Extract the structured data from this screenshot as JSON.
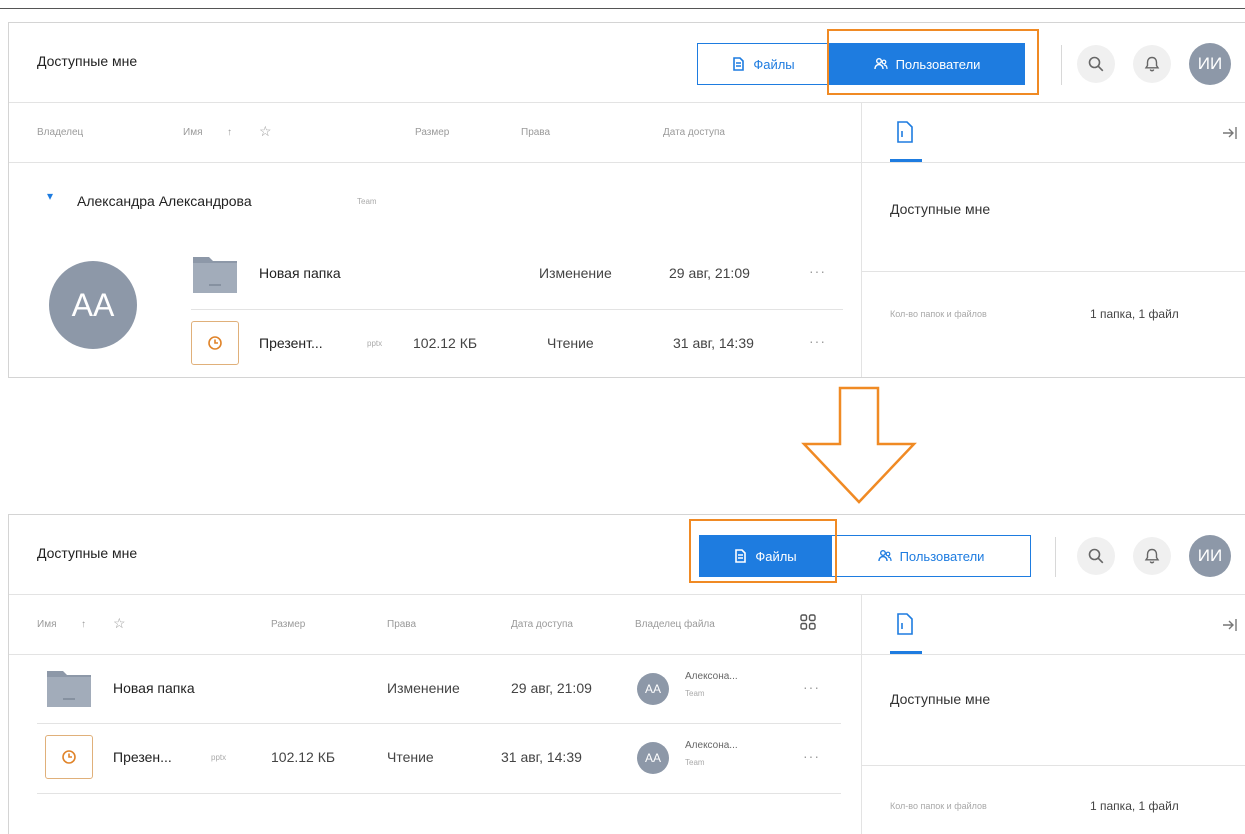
{
  "colors": {
    "accent": "#1e7ce0",
    "highlight": "#f08a24",
    "avatar": "#8d98a8"
  },
  "panel_top": {
    "title": "Доступные мне",
    "tab_files": "Файлы",
    "tab_users": "Пользователи",
    "user_initials": "ИИ",
    "columns": {
      "owner": "Владелец",
      "name": "Имя",
      "sort": "↑",
      "size": "Размер",
      "rights": "Права",
      "date": "Дата доступа"
    },
    "group": {
      "name": "Александра Александрова",
      "tag": "Team",
      "initials": "АА"
    },
    "rows": [
      {
        "name": "Новая папка",
        "ext": "",
        "size": "",
        "rights": "Изменение",
        "date": "29 авг, 21:09"
      },
      {
        "name": "Презент...",
        "ext": "pptx",
        "size": "102.12 КБ",
        "rights": "Чтение",
        "date": "31 авг, 14:39"
      }
    ],
    "more": "···",
    "right_panel": {
      "title": "Доступные мне",
      "count_label": "Кол-во папок и файлов",
      "count_value": "1 папка, 1 файл"
    }
  },
  "panel_bottom": {
    "title": "Доступные мне",
    "tab_files": "Файлы",
    "tab_users": "Пользователи",
    "user_initials": "ИИ",
    "columns": {
      "name": "Имя",
      "sort": "↑",
      "size": "Размер",
      "rights": "Права",
      "date": "Дата доступа",
      "owner": "Владелец файла"
    },
    "rows": [
      {
        "name": "Новая папка",
        "ext": "",
        "size": "",
        "rights": "Изменение",
        "date": "29 авг, 21:09",
        "owner_initials": "АА",
        "owner_name": "Алексона...",
        "owner_tag": "Team"
      },
      {
        "name": "Презен...",
        "ext": "pptx",
        "size": "102.12 КБ",
        "rights": "Чтение",
        "date": "31 авг, 14:39",
        "owner_initials": "АА",
        "owner_name": "Алексона...",
        "owner_tag": "Team"
      }
    ],
    "more": "···",
    "right_panel": {
      "title": "Доступные мне",
      "count_label": "Кол-во папок и файлов",
      "count_value": "1 папка, 1 файл"
    }
  }
}
